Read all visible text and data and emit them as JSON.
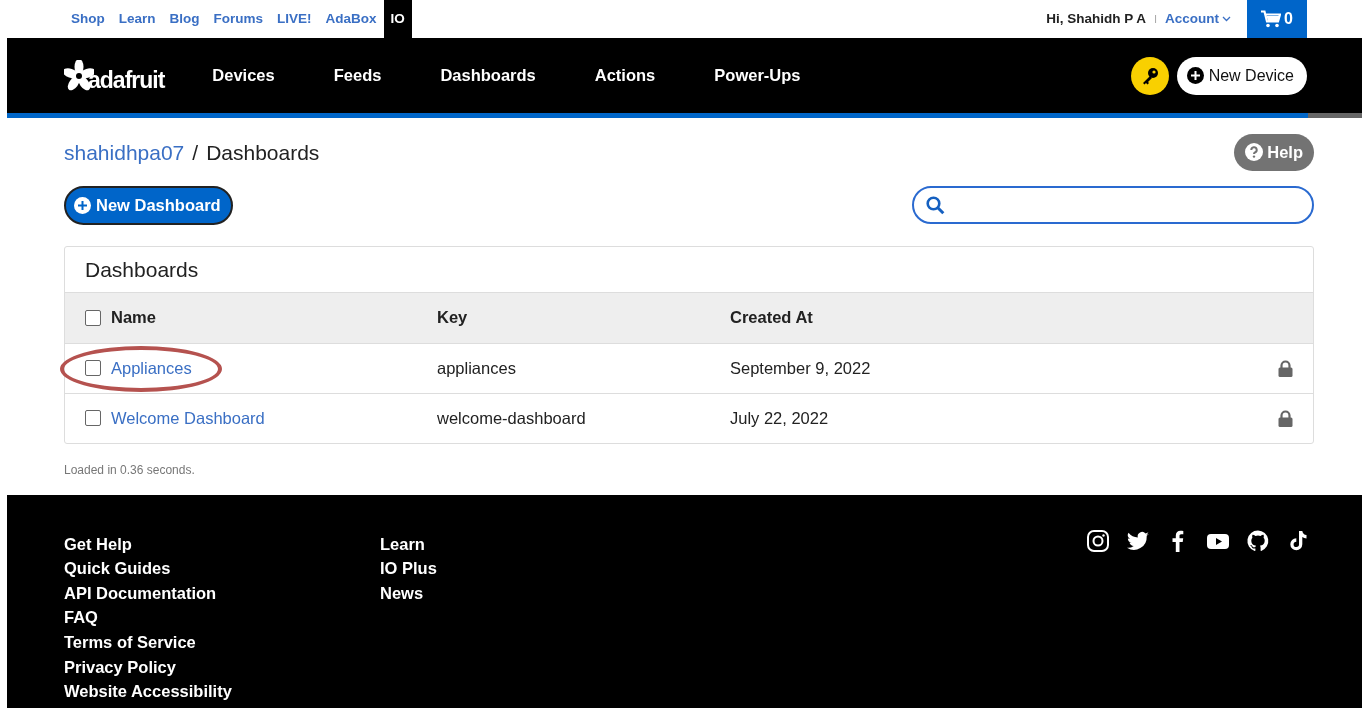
{
  "top_links": [
    {
      "label": "Shop",
      "selected": false
    },
    {
      "label": "Learn",
      "selected": false
    },
    {
      "label": "Blog",
      "selected": false
    },
    {
      "label": "Forums",
      "selected": false
    },
    {
      "label": "LIVE!",
      "selected": false
    },
    {
      "label": "AdaBox",
      "selected": false
    },
    {
      "label": "IO",
      "selected": true
    }
  ],
  "user": {
    "greeting": "Hi, Shahidh P A",
    "separator": "I",
    "account": "Account",
    "cart_count": "0"
  },
  "nav": {
    "logo_text": "adafruit",
    "items": [
      "Devices",
      "Feeds",
      "Dashboards",
      "Actions",
      "Power-Ups"
    ],
    "new_device": "New Device"
  },
  "breadcrumb": {
    "user": "shahidhpa07",
    "separator": "/",
    "page": "Dashboards"
  },
  "help": "Help",
  "new_dashboard": "New Dashboard",
  "table": {
    "title": "Dashboards",
    "columns": [
      "Name",
      "Key",
      "Created At"
    ],
    "header_checked": false,
    "rows": [
      {
        "name": "Appliances",
        "key": "appliances",
        "created": "September 9, 2022",
        "checked": false,
        "locked": true,
        "circled": true
      },
      {
        "name": "Welcome Dashboard",
        "key": "welcome-dashboard",
        "created": "July 22, 2022",
        "checked": false,
        "locked": true,
        "circled": false
      }
    ]
  },
  "load_time": "Loaded in 0.36 seconds.",
  "footer": {
    "column_1": [
      "Get Help",
      "Quick Guides",
      "API Documentation",
      "FAQ",
      "Terms of Service",
      "Privacy Policy",
      "Website Accessibility"
    ],
    "column_2": [
      "Learn",
      "IO Plus",
      "News"
    ]
  }
}
